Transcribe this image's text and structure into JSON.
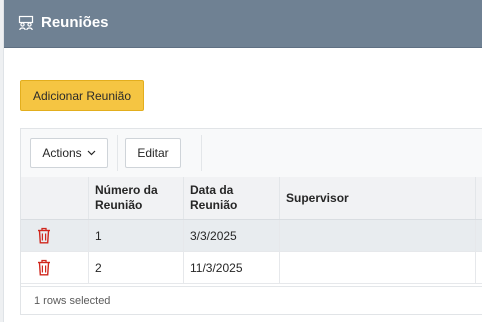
{
  "region": {
    "title": "Reuniões",
    "icon": "people-group-icon"
  },
  "add_button": {
    "label": "Adicionar Reunião"
  },
  "toolbar": {
    "actions_label": "Actions",
    "edit_label": "Editar"
  },
  "table": {
    "columns": [
      "",
      "Número da\nReunião",
      "Data da\nReunião",
      "Supervisor",
      ""
    ],
    "rows": [
      {
        "numero": "1",
        "data": "3/3/2025",
        "supervisor": "",
        "selected": true
      },
      {
        "numero": "2",
        "data": "11/3/2025",
        "supervisor": "",
        "selected": false
      }
    ]
  },
  "footer": {
    "status": "1 rows selected"
  },
  "colors": {
    "header_bg": "#6f8193",
    "primary_button": "#f5c542",
    "delete_icon": "#d0271d",
    "selected_row": "#e8ecef"
  }
}
